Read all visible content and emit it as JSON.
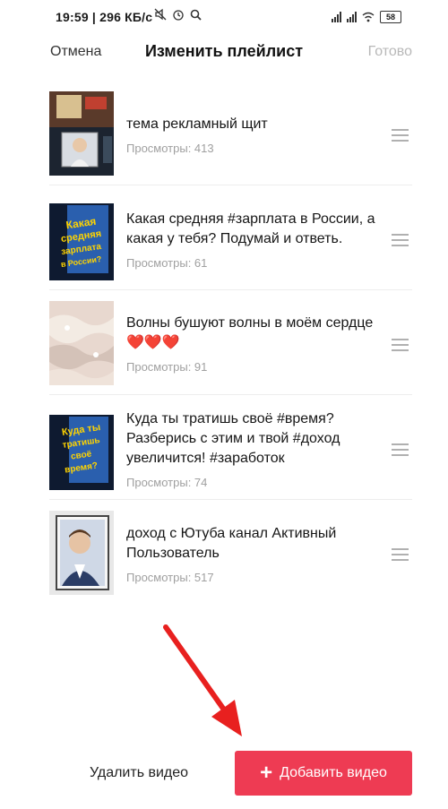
{
  "status": {
    "time": "19:59",
    "speed": "296 КБ/с",
    "battery": "58"
  },
  "header": {
    "cancel": "Отмена",
    "title": "Изменить плейлист",
    "done": "Готово"
  },
  "videos": [
    {
      "title": "тема рекламный щит",
      "views": "Просмотры: 413"
    },
    {
      "title": "Какая средняя #зарплата в России, а какая у тебя? Подумай и ответь.",
      "views": "Просмотры: 61",
      "thumb_text": "Какая средняя зарплата в России?"
    },
    {
      "title": "Волны бушуют волны в моём сердце ❤️❤️❤️",
      "views": "Просмотры: 91"
    },
    {
      "title": "Куда ты тратишь своё #время? Разберись с этим и твой #доход увеличится! #заработок",
      "views": "Просмотры: 74",
      "thumb_text": "Куда ты тратишь своё время?"
    },
    {
      "title": "доход с Ютуба канал Активный Пользователь",
      "views": "Просмотры: 517"
    }
  ],
  "actions": {
    "delete": "Удалить видео",
    "add": "Добавить видео"
  },
  "colors": {
    "accent": "#ee3b53",
    "annotation_arrow": "#e8201f"
  }
}
